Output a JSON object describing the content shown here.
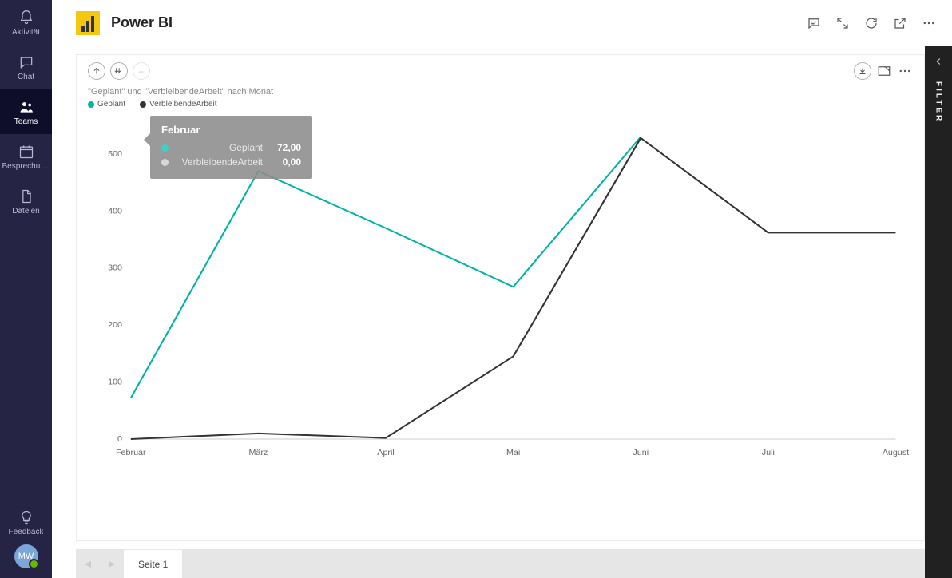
{
  "rail": {
    "items": [
      {
        "key": "aktivitaet",
        "label": "Aktivität"
      },
      {
        "key": "chat",
        "label": "Chat"
      },
      {
        "key": "teams",
        "label": "Teams"
      },
      {
        "key": "besprechungen",
        "label": "Besprechun..."
      },
      {
        "key": "dateien",
        "label": "Dateien"
      }
    ],
    "selected": "teams",
    "feedback_label": "Feedback",
    "avatar_initials": "MW"
  },
  "header": {
    "app_title": "Power BI"
  },
  "visual": {
    "subtitle": "\"Geplant\" und \"VerbleibendeArbeit\" nach Monat",
    "legend": [
      {
        "name": "Geplant",
        "color": "#00b3a4"
      },
      {
        "name": "VerbleibendeArbeit",
        "color": "#333333"
      }
    ]
  },
  "tooltip": {
    "title": "Februar",
    "rows": [
      {
        "label": "Geplant",
        "value": "72,00",
        "color": "#00b3a4"
      },
      {
        "label": "VerbleibendeArbeit",
        "value": "0,00",
        "color": "#bbbbbb"
      }
    ]
  },
  "page_tabs": {
    "current": "Seite 1"
  },
  "filter_panel": {
    "label": "FILTER"
  },
  "chart_data": {
    "type": "line",
    "title": "\"Geplant\" und \"VerbleibendeArbeit\" nach Monat",
    "xlabel": "",
    "ylabel": "",
    "ylim": [
      0,
      560
    ],
    "y_ticks": [
      0,
      100,
      200,
      300,
      400,
      500
    ],
    "categories": [
      "Februar",
      "März",
      "April",
      "Mai",
      "Juni",
      "Juli",
      "August"
    ],
    "series": [
      {
        "name": "Geplant",
        "color": "#00b3a4",
        "values": [
          72,
          470,
          370,
          267,
          530,
          null,
          null
        ]
      },
      {
        "name": "VerbleibendeArbeit",
        "color": "#333333",
        "values": [
          0,
          10,
          2,
          145,
          528,
          362,
          362
        ]
      }
    ]
  }
}
